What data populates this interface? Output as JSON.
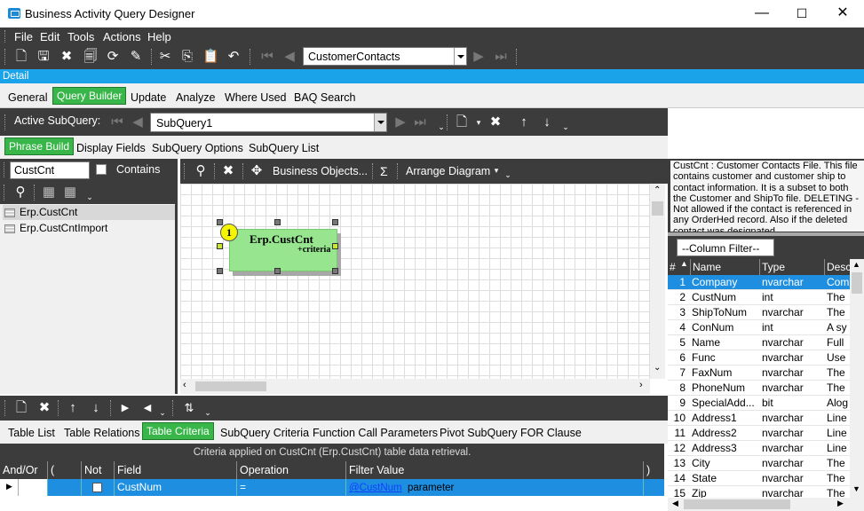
{
  "window": {
    "title": "Business Activity Query Designer",
    "min": "—",
    "max": "☐",
    "close": "✕"
  },
  "menu": [
    "File",
    "Edit",
    "Tools",
    "Actions",
    "Help"
  ],
  "toolbar": {
    "record_selector": "CustomerContacts"
  },
  "detail_label": "Detail",
  "main_tabs": [
    "General",
    "Query Builder",
    "Update",
    "Analyze",
    "Where Used",
    "BAQ Search"
  ],
  "active_subquery": {
    "label": "Active SubQuery:",
    "value": "SubQuery1"
  },
  "sub_tabs": [
    "Phrase Build",
    "Display Fields",
    "SubQuery Options",
    "SubQuery List"
  ],
  "search": {
    "value": "CustCnt",
    "contains_label": "Contains"
  },
  "table_list": [
    "Erp.CustCnt",
    "Erp.CustCntImport"
  ],
  "diagram_toolbar": {
    "business_objects": "Business Objects...",
    "sigma": "Σ",
    "arrange": "Arrange Diagram"
  },
  "diagram_table": {
    "number": "1",
    "name": "Erp.CustCnt",
    "criteria": "+criteria"
  },
  "bottom_tabs": [
    "Table List",
    "Table Relations",
    "Table Criteria",
    "SubQuery Criteria",
    "Function Call Parameters",
    "Pivot SubQuery FOR Clause"
  ],
  "criteria": {
    "caption": "Criteria applied on CustCnt (Erp.CustCnt)  table data retrieval.",
    "headers": [
      "And/Or",
      "(",
      "Not",
      "Field",
      "Operation",
      "Filter Value",
      ")"
    ],
    "row": {
      "field": "CustNum",
      "operation": "=",
      "filter_link": "@CustNum",
      "filter_suffix": "parameter"
    }
  },
  "description": "CustCnt : Customer Contacts File. This file contains customer and customer ship to contact information. It is a subset to both the Customer and ShipTo file. DELETING - Not allowed if the contact is referenced in any OrderHed record. Also if the deleted contact was designated",
  "column_filter": "--Column Filter--",
  "column_headers": [
    "#",
    "Name",
    "Type",
    "Desc"
  ],
  "columns": [
    {
      "n": "1",
      "name": "Company",
      "type": "nvarchar",
      "desc": "Com"
    },
    {
      "n": "2",
      "name": "CustNum",
      "type": "int",
      "desc": "The"
    },
    {
      "n": "3",
      "name": "ShipToNum",
      "type": "nvarchar",
      "desc": "The"
    },
    {
      "n": "4",
      "name": "ConNum",
      "type": "int",
      "desc": "A sy"
    },
    {
      "n": "5",
      "name": "Name",
      "type": "nvarchar",
      "desc": "Full"
    },
    {
      "n": "6",
      "name": "Func",
      "type": "nvarchar",
      "desc": "Use"
    },
    {
      "n": "7",
      "name": "FaxNum",
      "type": "nvarchar",
      "desc": "The"
    },
    {
      "n": "8",
      "name": "PhoneNum",
      "type": "nvarchar",
      "desc": "The"
    },
    {
      "n": "9",
      "name": "SpecialAdd...",
      "type": "bit",
      "desc": "Alog"
    },
    {
      "n": "10",
      "name": "Address1",
      "type": "nvarchar",
      "desc": "Line"
    },
    {
      "n": "11",
      "name": "Address2",
      "type": "nvarchar",
      "desc": "Line"
    },
    {
      "n": "12",
      "name": "Address3",
      "type": "nvarchar",
      "desc": "Line"
    },
    {
      "n": "13",
      "name": "City",
      "type": "nvarchar",
      "desc": "The"
    },
    {
      "n": "14",
      "name": "State",
      "type": "nvarchar",
      "desc": "The"
    },
    {
      "n": "15",
      "name": "Zip",
      "type": "nvarchar",
      "desc": "The"
    }
  ],
  "colors": {
    "accent_green": "#38b649",
    "header_blue": "#1aa3e8",
    "selection_blue": "#1e8fe0",
    "dark_chrome": "#3c3c3c"
  }
}
